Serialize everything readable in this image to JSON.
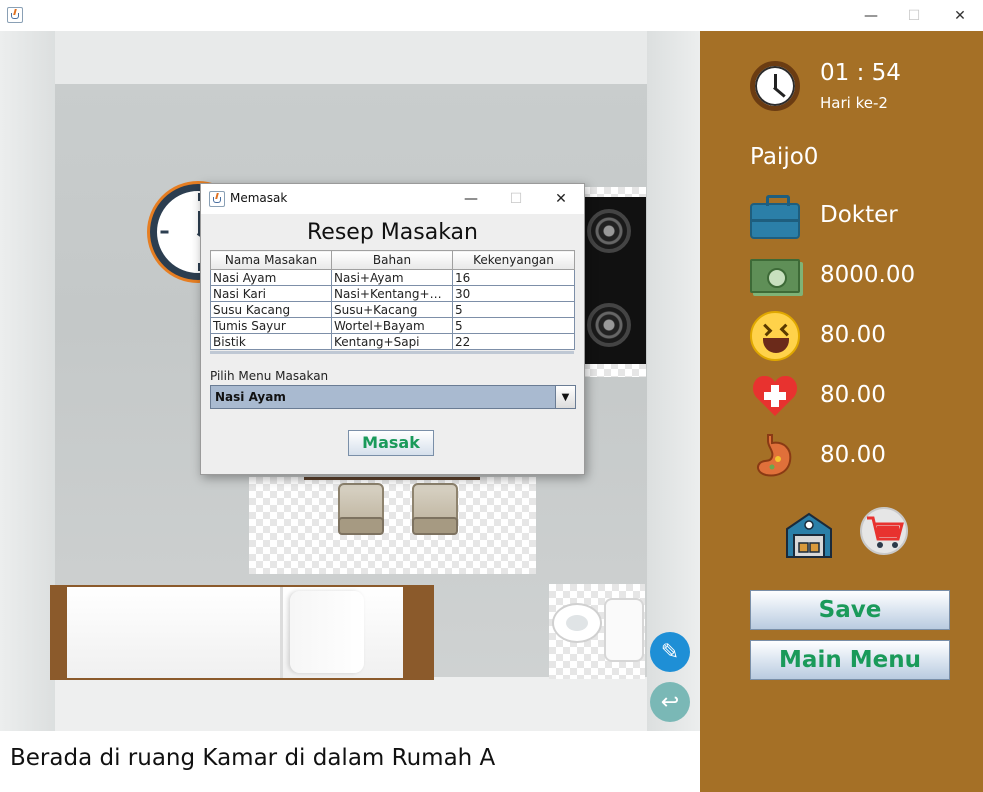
{
  "window": {
    "title": "",
    "controls": {
      "minimize": "—",
      "maximize": "☐",
      "close": "✕"
    }
  },
  "room": {
    "location_text": "Berada di ruang Kamar di dalam Rumah A"
  },
  "status": {
    "time": "01 : 54",
    "day": "Hari ke-2",
    "player_name": "Paijo0",
    "job": "Dokter",
    "money": "8000.00",
    "happiness": "80.00",
    "health": "80.00",
    "hunger": "80.00"
  },
  "buttons": {
    "save": "Save",
    "main_menu": "Main Menu"
  },
  "icons": {
    "clock": "clock-icon",
    "job": "briefcase-icon",
    "money": "money-icon",
    "happiness": "laughing-face-icon",
    "health": "heart-plus-icon",
    "hunger": "stomach-icon",
    "warehouse": "warehouse-icon",
    "cart": "shopping-cart-icon",
    "edit": "pencil-icon",
    "back": "back-arrow-icon"
  },
  "dialog": {
    "title": "Memasak",
    "controls": {
      "minimize": "—",
      "maximize": "☐",
      "close": "✕"
    },
    "heading": "Resep Masakan",
    "table": {
      "columns": [
        "Nama Masakan",
        "Bahan",
        "Kekenyangan"
      ],
      "rows": [
        [
          "Nasi Ayam",
          "Nasi+Ayam",
          "16"
        ],
        [
          "Nasi Kari",
          "Nasi+Kentang+Wor...",
          "30"
        ],
        [
          "Susu Kacang",
          "Susu+Kacang",
          "5"
        ],
        [
          "Tumis Sayur",
          "Wortel+Bayam",
          "5"
        ],
        [
          "Bistik",
          "Kentang+Sapi",
          "22"
        ]
      ]
    },
    "select_label": "Pilih Menu Masakan",
    "selected_menu": "Nasi Ayam",
    "cook_button": "Masak"
  },
  "colors": {
    "sidebar_bg": "#a57026",
    "button_text": "#1a9a5a",
    "select_bg": "#a9bad0"
  }
}
